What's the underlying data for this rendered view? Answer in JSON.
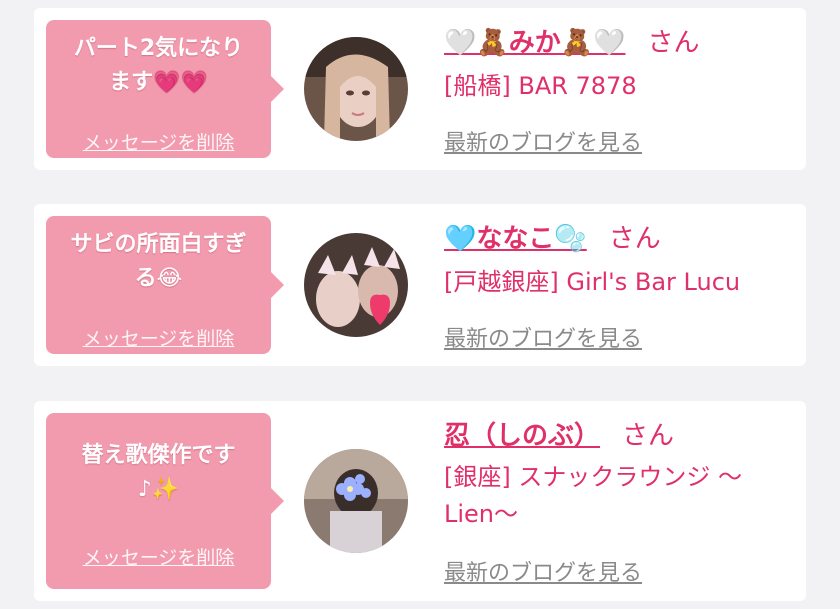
{
  "delete_label": "メッセージを削除",
  "blog_label": "最新のブログを見る",
  "honorific": "さん",
  "colors": {
    "bubble": "#f29bae",
    "accent": "#e0306a",
    "link_gray": "#8a8a8a"
  },
  "messages": [
    {
      "text": "パート2気になります💗💗",
      "text_line1": "パート2気になり",
      "text_line2": "ます💗💗",
      "name": "🤍🧸みか🧸🤍",
      "shop": "[船橋] BAR 7878"
    },
    {
      "text": "サビの所面白すぎる😂",
      "text_line1": "サビの所面白すぎ",
      "text_line2": "る😂",
      "name": "🩵ななこ🫧",
      "shop": "[戸越銀座] Girl's Bar Lucu"
    },
    {
      "text": "替え歌傑作です♪✨",
      "text_line1": "替え歌傑作です",
      "text_line2": "♪✨",
      "name": "忍（しのぶ）",
      "shop": "[銀座] スナックラウンジ 〜Lien〜"
    }
  ]
}
